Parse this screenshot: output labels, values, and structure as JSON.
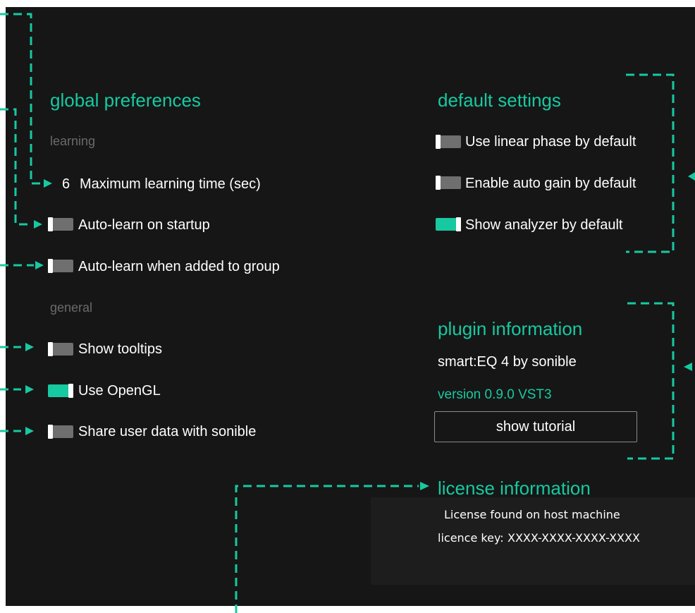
{
  "colors": {
    "accent": "#17c9a1",
    "background": "#161616",
    "toggle_off": "#6f6f6f",
    "muted": "#6a6a6a"
  },
  "global_preferences": {
    "title": "global preferences",
    "learning": {
      "label": "learning",
      "max_time_value": "6",
      "max_time_label": "Maximum learning time (sec)",
      "auto_learn_startup": {
        "label": "Auto-learn on startup",
        "on": false
      },
      "auto_learn_group": {
        "label": "Auto-learn when added to group",
        "on": false
      }
    },
    "general": {
      "label": "general",
      "show_tooltips": {
        "label": "Show tooltips",
        "on": false
      },
      "use_opengl": {
        "label": "Use OpenGL",
        "on": true
      },
      "share_data": {
        "label": "Share user data with sonible",
        "on": false
      }
    }
  },
  "default_settings": {
    "title": "default settings",
    "linear_phase": {
      "label": "Use linear phase by default",
      "on": false
    },
    "auto_gain": {
      "label": "Enable auto gain by default",
      "on": false
    },
    "show_analyzer": {
      "label": "Show analyzer by default",
      "on": true
    }
  },
  "plugin_information": {
    "title": "plugin information",
    "product": "smart:EQ 4 by sonible",
    "version": "version 0.9.0 VST3",
    "tutorial_button": "show tutorial"
  },
  "license_information": {
    "title": "license information",
    "status": "License found on host machine",
    "key_label": "licence key:",
    "key_value": "XXXX-XXXX-XXXX-XXXX"
  }
}
